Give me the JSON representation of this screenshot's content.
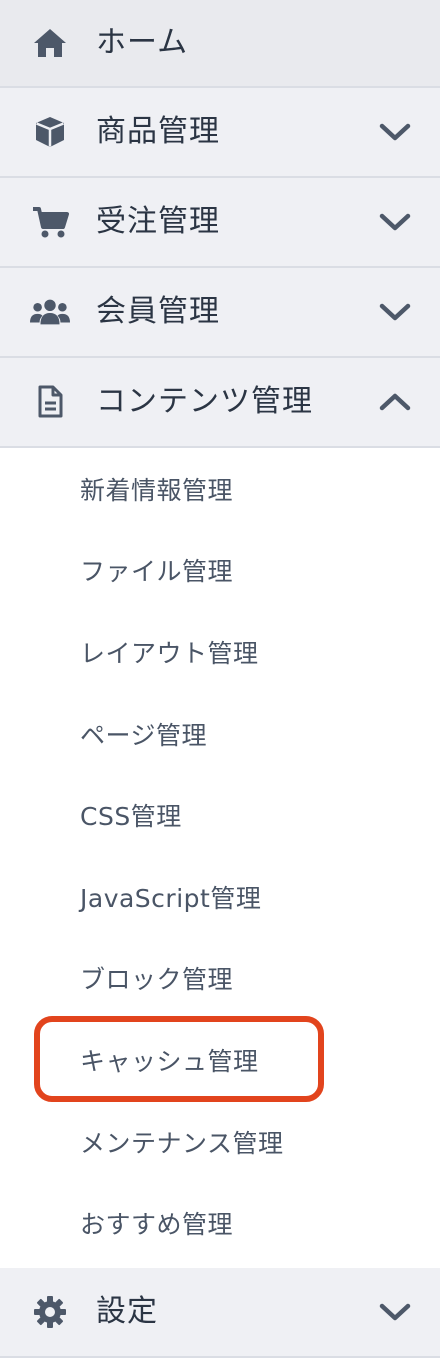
{
  "menu": {
    "home": {
      "label": "ホーム",
      "icon": "home-icon"
    },
    "products": {
      "label": "商品管理",
      "icon": "box-icon"
    },
    "orders": {
      "label": "受注管理",
      "icon": "cart-icon"
    },
    "members": {
      "label": "会員管理",
      "icon": "users-icon"
    },
    "contents": {
      "label": "コンテンツ管理",
      "icon": "file-icon",
      "expanded": true,
      "items": [
        {
          "label": "新着情報管理"
        },
        {
          "label": "ファイル管理"
        },
        {
          "label": "レイアウト管理"
        },
        {
          "label": "ページ管理"
        },
        {
          "label": "CSS管理"
        },
        {
          "label": "JavaScript管理"
        },
        {
          "label": "ブロック管理"
        },
        {
          "label": "キャッシュ管理",
          "highlighted": true
        },
        {
          "label": "メンテナンス管理"
        },
        {
          "label": "おすすめ管理"
        }
      ]
    },
    "settings": {
      "label": "設定",
      "icon": "gear-icon"
    }
  },
  "colors": {
    "text": "#2b3544",
    "submenu_text": "#4a5566",
    "menu_bg": "#eff0f4",
    "highlight": "#e2441d"
  }
}
